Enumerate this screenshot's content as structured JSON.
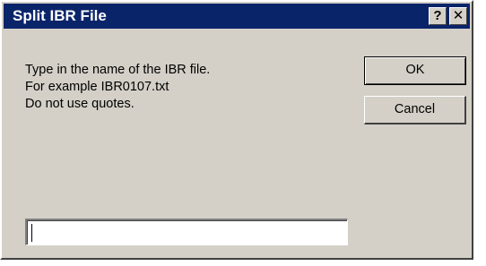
{
  "window": {
    "title": "Split IBR File",
    "help_label": "?",
    "close_label": "✕"
  },
  "message": {
    "lines": [
      "Type in the name of the IBR file.",
      "For example IBR0107.txt",
      "Do not use quotes."
    ]
  },
  "buttons": {
    "ok_label": "OK",
    "cancel_label": "Cancel"
  },
  "input": {
    "value": "",
    "placeholder": ""
  },
  "colors": {
    "titlebar": "#0a246a",
    "dialog_face": "#d4d0c8"
  }
}
